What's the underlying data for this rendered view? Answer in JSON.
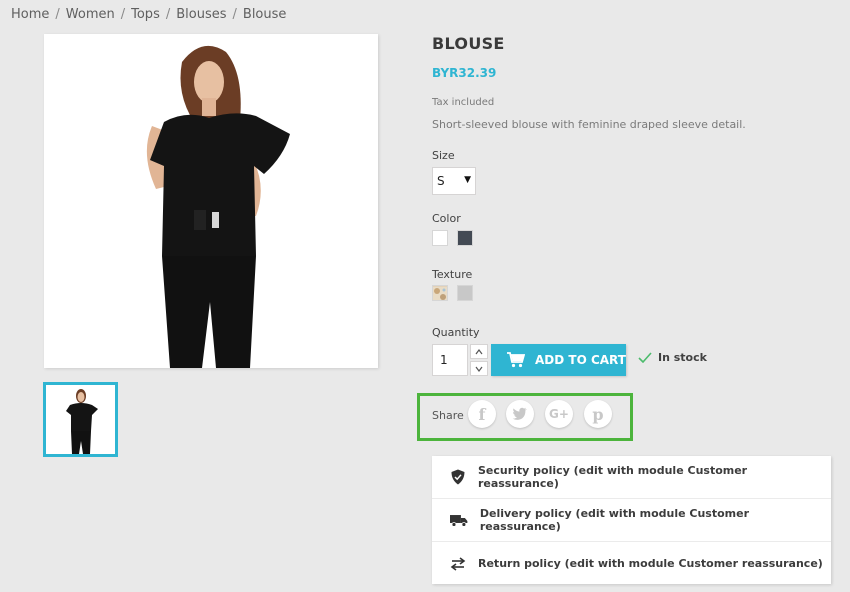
{
  "breadcrumb": [
    "Home",
    "Women",
    "Tops",
    "Blouses",
    "Blouse"
  ],
  "breadcrumb_separator": "/",
  "product": {
    "title": "BLOUSE",
    "price": "BYR32.39",
    "tax_note": "Tax included",
    "description": "Short-sleeved blouse with feminine draped sleeve detail."
  },
  "size": {
    "label": "Size",
    "selected": "S"
  },
  "color": {
    "label": "Color",
    "swatches": [
      "#ffffff",
      "#434a54"
    ]
  },
  "texture": {
    "label": "Texture"
  },
  "quantity": {
    "label": "Quantity",
    "value": "1"
  },
  "cart": {
    "add_label": "ADD TO CART",
    "stock_label": "In stock"
  },
  "share": {
    "label": "Share",
    "networks": [
      "facebook-icon",
      "twitter-icon",
      "google-plus-icon",
      "pinterest-icon"
    ]
  },
  "reassurance": [
    {
      "icon": "shield-icon",
      "text": "Security policy (edit with module Customer reassurance)"
    },
    {
      "icon": "truck-icon",
      "text": "Delivery policy (edit with module Customer reassurance)"
    },
    {
      "icon": "arrows-icon",
      "text": "Return policy (edit with module Customer reassurance)"
    }
  ],
  "colors": {
    "accent": "#2fb5d2",
    "highlight": "#4cb43c",
    "background": "#e9e9e9"
  }
}
